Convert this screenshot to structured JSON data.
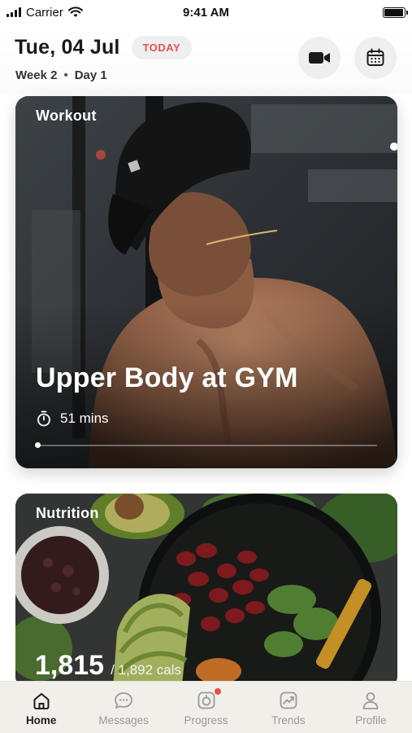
{
  "status_bar": {
    "carrier": "Carrier",
    "time": "9:41 AM",
    "battery_level": 0.95
  },
  "header": {
    "date": "Tue, 04 Jul",
    "today_badge": "TODAY",
    "week": "Week 2",
    "separator": "•",
    "day": "Day 1",
    "buttons": [
      {
        "icon": "video-camera-icon"
      },
      {
        "icon": "calendar-icon"
      }
    ]
  },
  "workout": {
    "label": "Workout",
    "title": "Upper Body at GYM",
    "duration": "51 mins",
    "progress": 0.0
  },
  "nutrition": {
    "label": "Nutrition",
    "calories_consumed": "1,815",
    "calories_goal": "/ 1,892 cals"
  },
  "tab_bar": {
    "tabs": [
      {
        "label": "Home",
        "icon": "home-icon",
        "active": true
      },
      {
        "label": "Messages",
        "icon": "chat-bubble-icon",
        "active": false
      },
      {
        "label": "Progress",
        "icon": "progress-icon",
        "active": false,
        "badge": true
      },
      {
        "label": "Trends",
        "icon": "trend-chart-icon",
        "active": false
      },
      {
        "label": "Profile",
        "icon": "person-icon",
        "active": false
      }
    ]
  },
  "colors": {
    "accent": "#e5534b",
    "tab_bar_bg": "#f1efea",
    "badge_bg": "#efefef"
  }
}
